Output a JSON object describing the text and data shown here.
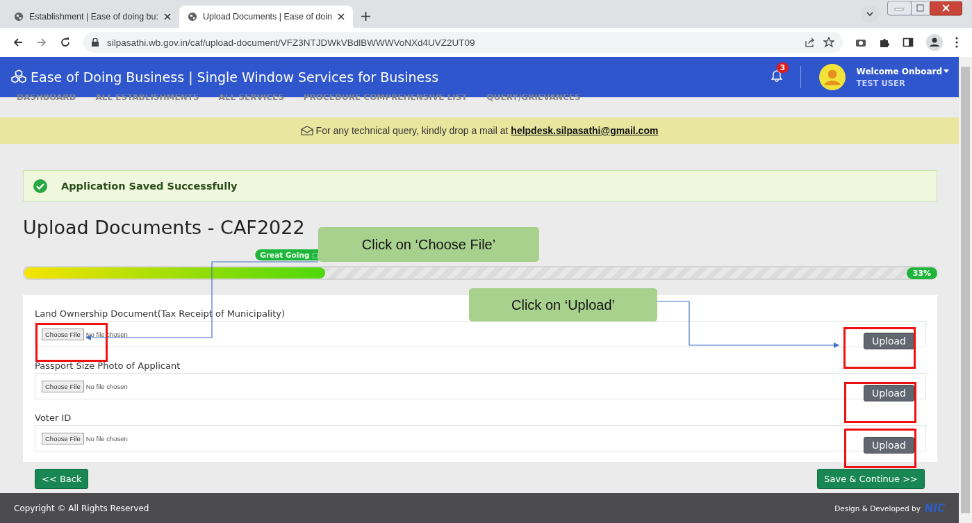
{
  "browser": {
    "tabs": [
      {
        "title": "Establishment | Ease of doing bu:",
        "selected": false
      },
      {
        "title": "Upload Documents | Ease of doin",
        "selected": true
      }
    ],
    "url": "silpasathi.wb.gov.in/caf/upload-document/VFZ3NTJDWkVBdlBWWWVoNXd4UVZ2UT09"
  },
  "header": {
    "title": "Ease of Doing Business | Single Window Services for Business",
    "notifications": "3",
    "welcome": "Welcome Onboard",
    "user": "TEST USER"
  },
  "nav": [
    "DASHBOARD",
    "ALL ESTABLISHMENTS",
    "ALL SERVICES",
    "PROCEDURE COMPREHENSIVE LIST",
    "QUERY/GRIEVANCES"
  ],
  "notice": {
    "text": "For any technical query, kindly drop a mail at",
    "email": "helpdesk.silpasathi@gmail.com"
  },
  "alert": "Application Saved Successfully",
  "page_title": "Upload Documents - CAF2022",
  "progress": {
    "badge": "Great Going □",
    "level": 0.33,
    "reading": "33%"
  },
  "documents": [
    {
      "label": "Land Ownership Document(Tax Receipt of Municipality)",
      "choose": "Choose File",
      "status": "No file chosen",
      "action": "Upload"
    },
    {
      "label": "Passport Size Photo of Applicant",
      "choose": "Choose File",
      "status": "No file chosen",
      "action": "Upload"
    },
    {
      "label": "Voter ID",
      "choose": "Choose File",
      "status": "No file chosen",
      "action": "Upload"
    }
  ],
  "buttons": {
    "back": "<< Back",
    "save": "Save & Continue >>"
  },
  "footer": {
    "copyright": "Copyright © All Rights Reserved",
    "credit": "Design & Developed by",
    "logo": "NIC"
  },
  "callouts": [
    "Click on ‘Choose File’",
    "Click on ‘Upload’"
  ]
}
